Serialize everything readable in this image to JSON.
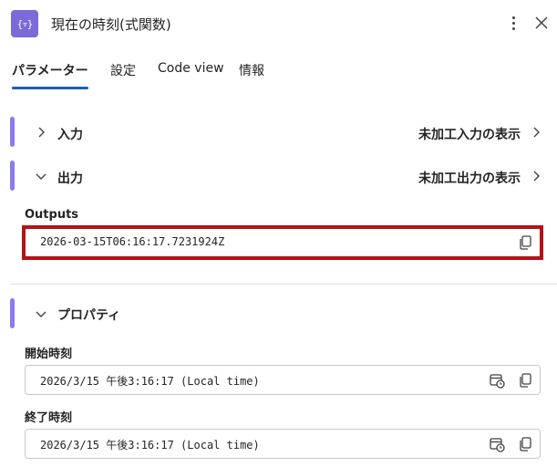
{
  "header": {
    "app_icon_text": "{▿}",
    "title": "現在の時刻(式関数)"
  },
  "tabs": [
    {
      "label": "パラメーター",
      "active": true
    },
    {
      "label": "設定",
      "active": false
    },
    {
      "label": "Code view",
      "active": false
    },
    {
      "label": "情報",
      "active": false
    }
  ],
  "sections": {
    "input": {
      "label": "入力",
      "raw_link": "未加工入力の表示",
      "expanded": false
    },
    "output": {
      "label": "出力",
      "raw_link": "未加工出力の表示",
      "expanded": true
    },
    "properties": {
      "label": "プロパティ",
      "expanded": true
    }
  },
  "outputs": {
    "label": "Outputs",
    "value": "2026-03-15T06:16:17.7231924Z"
  },
  "properties": {
    "start": {
      "label": "開始時刻",
      "value": "2026/3/15 午後3:16:17 (Local time)"
    },
    "end": {
      "label": "終了時刻",
      "value": "2026/3/15 午後3:16:17 (Local time)"
    }
  },
  "colors": {
    "accent": "#8a7cf0",
    "app_icon": "#7b6ad8",
    "tab_underline": "#1a5fb4",
    "highlight": "#b31318"
  }
}
